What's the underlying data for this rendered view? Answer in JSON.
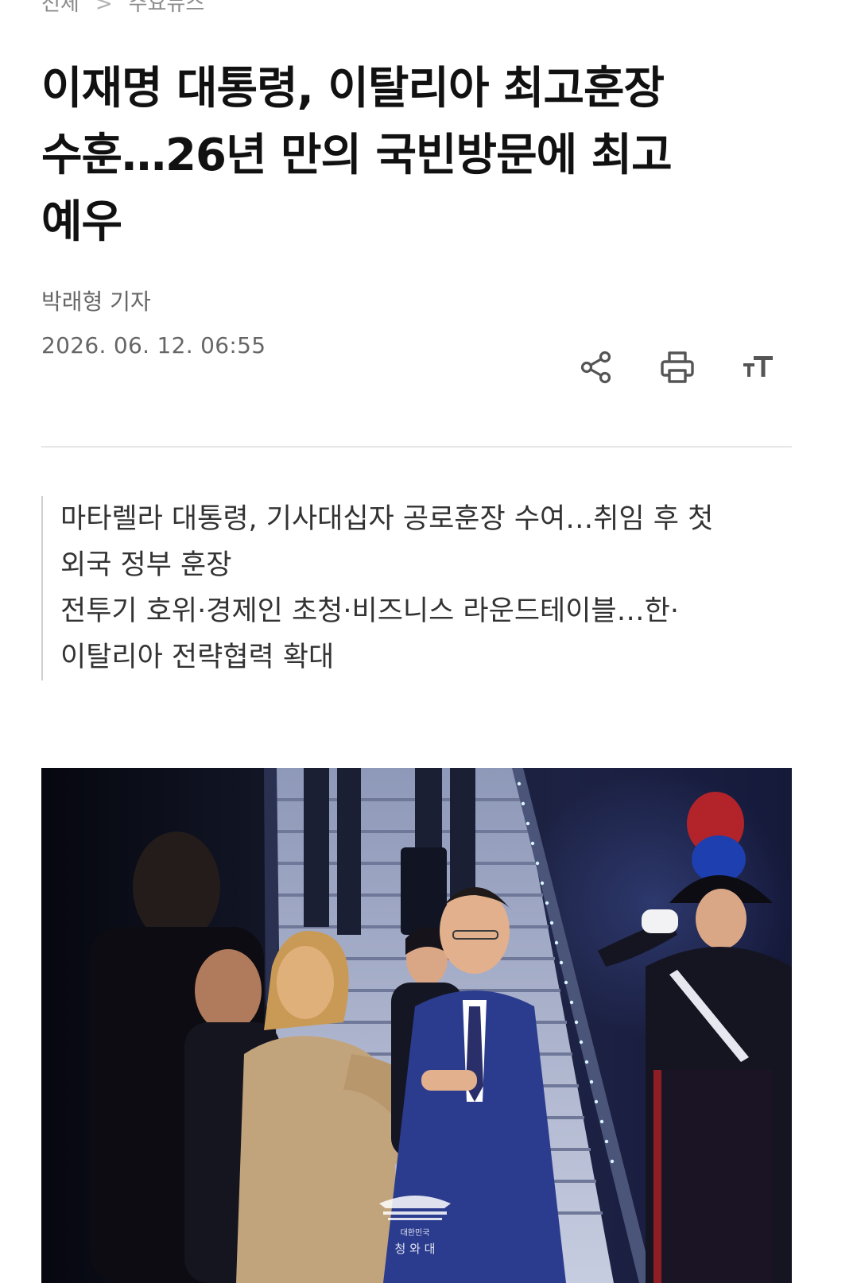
{
  "breadcrumb": {
    "items": [
      "전체",
      "주요뉴스"
    ],
    "separator": ">"
  },
  "article": {
    "headline_lines": [
      "이재명 대통령, 이탈리아 최고훈장",
      "수훈…26년 만의 국빈방문에 최고",
      "예우"
    ],
    "reporter": "박래형 기자",
    "datetime": "2026. 06. 12. 06:55",
    "summary": [
      "마타렐라 대통령, 기사대십자 공로훈장 수여…취임 후 첫",
      "외국 정부 훈장",
      "전투기 호위·경제인 초청·비즈니스 라운드테이블…한·",
      "이탈리아 전략협력 확대"
    ]
  },
  "toolbar": {
    "icons": [
      "share-icon",
      "print-icon",
      "font-size-icon"
    ],
    "font_glyph": "тT"
  },
  "photo": {
    "watermark": "청 와 대",
    "watermark_small": "대한민국"
  },
  "colors": {
    "headline": "#111111",
    "meta": "#666666",
    "divider": "#e6e6e6",
    "icon": "#555555",
    "suit": "#2b3c8f"
  }
}
